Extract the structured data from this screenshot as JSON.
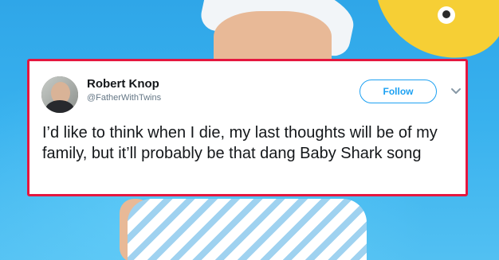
{
  "tweet": {
    "name": "Robert Knop",
    "handle": "@FatherWithTwins",
    "follow_label": "Follow",
    "text": "I’d like to think when I die, my last thoughts will be of my family, but it’ll probably be that dang Baby Shark song",
    "menu_icon": "chevron-down-icon",
    "border_color": "#e5173f",
    "accent_color": "#1da1f2"
  }
}
